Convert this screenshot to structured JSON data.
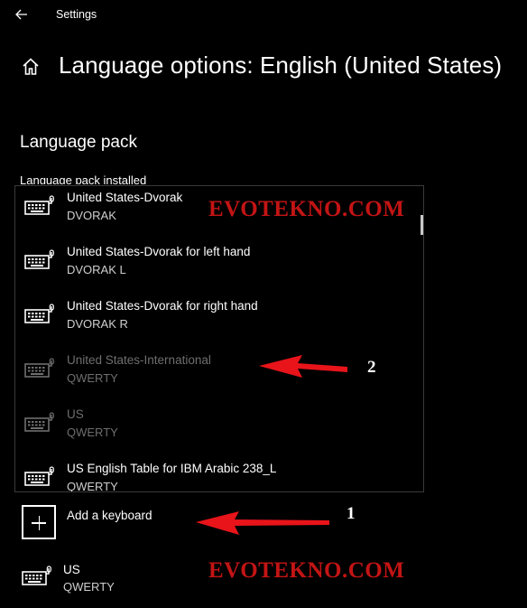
{
  "window": {
    "title": "Settings"
  },
  "header": {
    "title": "Language options: English (United States)"
  },
  "language_pack": {
    "section_title": "Language pack",
    "status_label": "Language pack installed"
  },
  "keyboard_list": [
    {
      "name": "United States-Dvorak",
      "layout": "DVORAK",
      "state": "enabled"
    },
    {
      "name": "United States-Dvorak for left hand",
      "layout": "DVORAK L",
      "state": "enabled"
    },
    {
      "name": "United States-Dvorak for right hand",
      "layout": "DVORAK R",
      "state": "enabled"
    },
    {
      "name": "United States-International",
      "layout": "QWERTY",
      "state": "disabled"
    },
    {
      "name": "US",
      "layout": "QWERTY",
      "state": "disabled"
    },
    {
      "name": "US English Table for IBM Arabic 238_L",
      "layout": "QWERTY",
      "state": "enabled"
    }
  ],
  "add_keyboard": {
    "label": "Add a keyboard"
  },
  "installed_keyboard": {
    "name": "US",
    "layout": "QWERTY"
  },
  "annotations": {
    "watermark": "EVOTEKNO.COM",
    "callout_1": "1",
    "callout_2": "2",
    "arrow_color": "#e8141a"
  },
  "colors": {
    "background": "#000000",
    "text": "#ffffff",
    "disabled_text": "#6e6e6e",
    "watermark": "#c31414"
  },
  "icons": {
    "back": "back-arrow-icon",
    "home": "home-icon",
    "keyboard": "keyboard-icon",
    "add": "plus-icon"
  }
}
